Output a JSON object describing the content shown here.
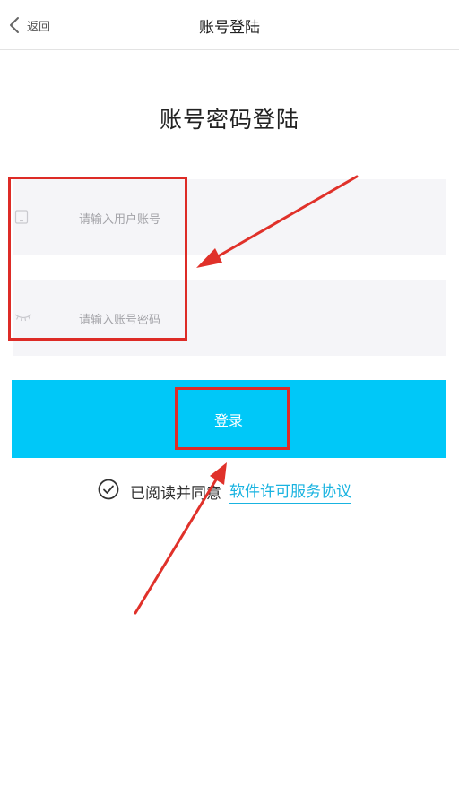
{
  "nav": {
    "back_label": "返回",
    "title": "账号登陆"
  },
  "heading": "账号密码登陆",
  "form": {
    "username_placeholder": "请输入用户账号",
    "password_placeholder": "请输入账号密码",
    "login_label": "登录"
  },
  "agreement": {
    "text": "已阅读并同意",
    "link_text": "软件许可服务协议",
    "checked": true
  },
  "colors": {
    "accent": "#00c8f8",
    "link": "#19b3e0",
    "annotation": "#dd2b26",
    "field_bg": "#f5f5f8"
  },
  "icons": {
    "back": "chevron-left-icon",
    "username": "phone-icon",
    "password": "eye-closed-icon",
    "agreement": "check-circle-icon"
  }
}
